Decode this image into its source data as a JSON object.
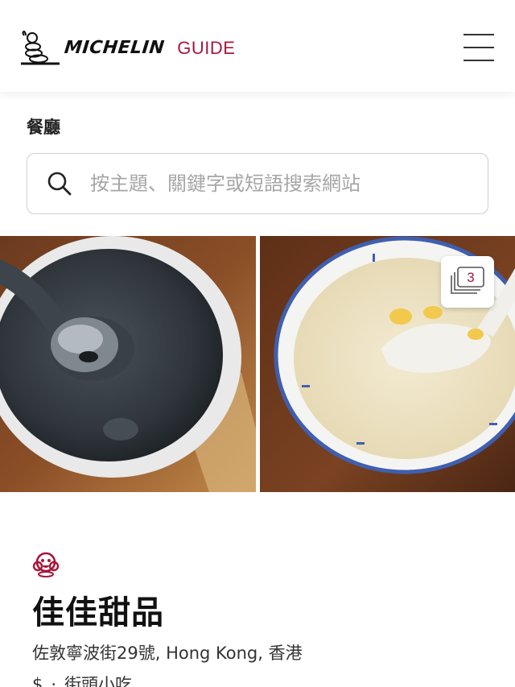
{
  "header": {
    "brand_word": "MICHELIN",
    "brand_guide": "GUIDE",
    "brand_color": "#a8173b"
  },
  "section": {
    "label": "餐廳"
  },
  "search": {
    "placeholder": "按主題、關鍵字或短語搜索網站",
    "value": ""
  },
  "gallery": {
    "photo_count": "3"
  },
  "restaurant": {
    "distinction_icon": "bib-gourmand-icon",
    "name": "佳佳甜品",
    "address": "佐敦寧波街29號, Hong Kong, 香港",
    "price": "$",
    "separator": "·",
    "cuisine": "街頭小吃"
  }
}
